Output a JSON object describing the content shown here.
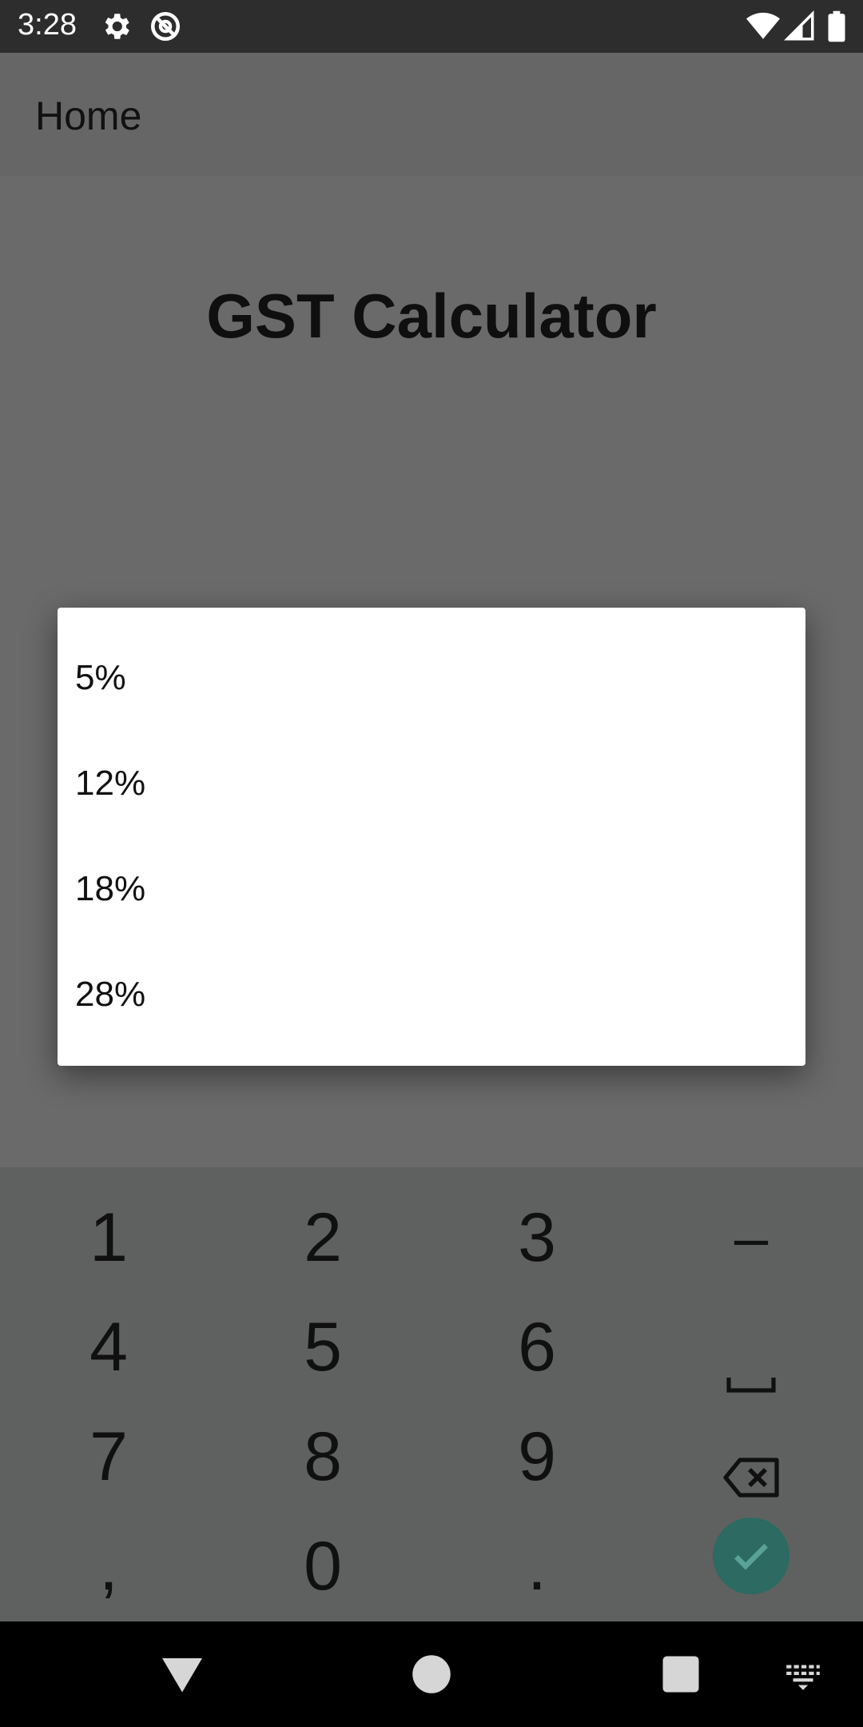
{
  "status_bar": {
    "time": "3:28",
    "icons": [
      "gear-icon",
      "assistant-icon",
      "wifi-icon",
      "signal-icon",
      "battery-icon"
    ]
  },
  "app_bar": {
    "title": "Home"
  },
  "main": {
    "title": "GST Calculator"
  },
  "dialog": {
    "options": [
      "5%",
      "12%",
      "18%",
      "28%"
    ]
  },
  "keyboard": {
    "rows": [
      [
        "1",
        "2",
        "3",
        "–"
      ],
      [
        "4",
        "5",
        "6",
        "space-icon"
      ],
      [
        "7",
        "8",
        "9",
        "backspace-icon"
      ],
      [
        ",",
        "0",
        ".",
        "done-icon"
      ]
    ],
    "accent": "#2c6a62"
  },
  "nav_bar": {
    "buttons": [
      "back-icon",
      "home-icon",
      "recents-icon",
      "keyboard-switch-icon"
    ]
  },
  "colors": {
    "status_bar": "#2d2d2d",
    "scrim": "#6a6a6a",
    "dialog": "#ffffff",
    "keyboard": "#5f6160"
  }
}
